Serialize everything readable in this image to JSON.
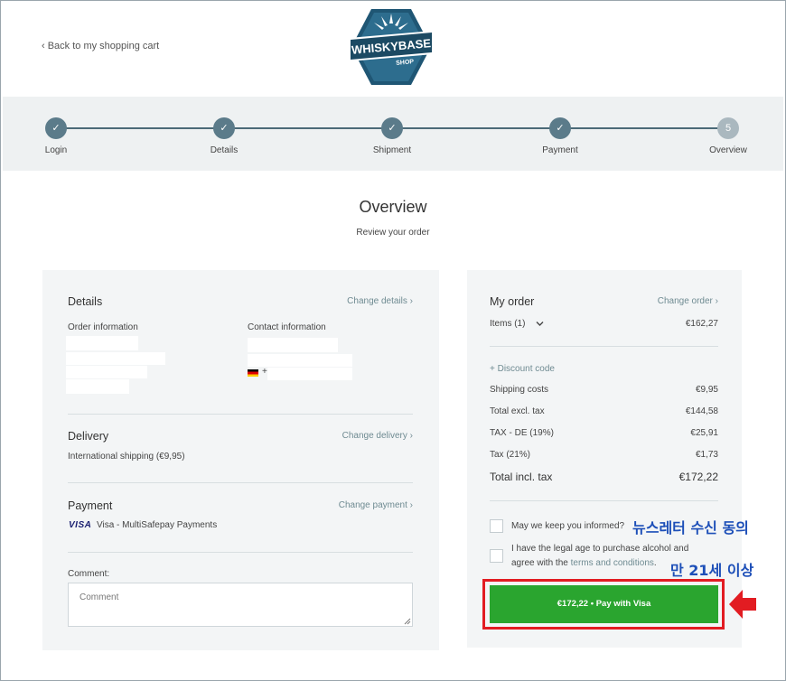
{
  "header": {
    "back_link": "‹ Back to my shopping cart",
    "logo_text_main": "WHISKYBASE",
    "logo_text_sub": "SHOP"
  },
  "steps": [
    {
      "label": "Login",
      "state": "done",
      "symbol": "✓"
    },
    {
      "label": "Details",
      "state": "done",
      "symbol": "✓"
    },
    {
      "label": "Shipment",
      "state": "done",
      "symbol": "✓"
    },
    {
      "label": "Payment",
      "state": "done",
      "symbol": "✓"
    },
    {
      "label": "Overview",
      "state": "current",
      "symbol": "5"
    }
  ],
  "page": {
    "title": "Overview",
    "subtitle": "Review your order"
  },
  "details": {
    "title": "Details",
    "change": "Change details ›",
    "order_info_label": "Order information",
    "contact_info_label": "Contact information",
    "phone_prefix": "+"
  },
  "delivery": {
    "title": "Delivery",
    "change": "Change delivery ›",
    "value": "International shipping (€9,95)"
  },
  "payment": {
    "title": "Payment",
    "change": "Change payment ›",
    "card_brand": "VISA",
    "value": "Visa - MultiSafepay Payments"
  },
  "comment": {
    "label": "Comment:",
    "placeholder": "Comment"
  },
  "order": {
    "title": "My order",
    "change": "Change order ›",
    "items_label": "Items (1)",
    "items_value": "€162,27",
    "discount_link": "+ Discount code",
    "rows": [
      {
        "label": "Shipping costs",
        "value": "€9,95"
      },
      {
        "label": "Total excl. tax",
        "value": "€144,58"
      },
      {
        "label": "TAX - DE (19%)",
        "value": "€25,91"
      },
      {
        "label": "Tax (21%)",
        "value": "€1,73"
      }
    ],
    "total_label": "Total incl. tax",
    "total_value": "€172,22"
  },
  "consent": {
    "newsletter": "May we keep you informed?",
    "age_line1": "I have the legal age to purchase alcohol and",
    "age_line2_prefix": "agree with the ",
    "age_terms_link": "terms and conditions",
    "age_line2_suffix": "."
  },
  "pay_button": {
    "label": "€172,22 •  Pay with Visa"
  },
  "annotations": {
    "newsletter_note": "뉴스레터 수신 동의",
    "age_note": "만 21세 이상"
  },
  "colors": {
    "accent": "#5b7b8a",
    "pay_green": "#2aa52f",
    "highlight_red": "#e21c22",
    "annotation_blue": "#1d4fb8",
    "link_teal": "#6f8b92"
  },
  "icons": {
    "step_done": "checkmark-icon",
    "items_toggle": "chevron-down-icon",
    "flag": "germany-flag-icon",
    "arrow": "left-arrow-icon"
  }
}
